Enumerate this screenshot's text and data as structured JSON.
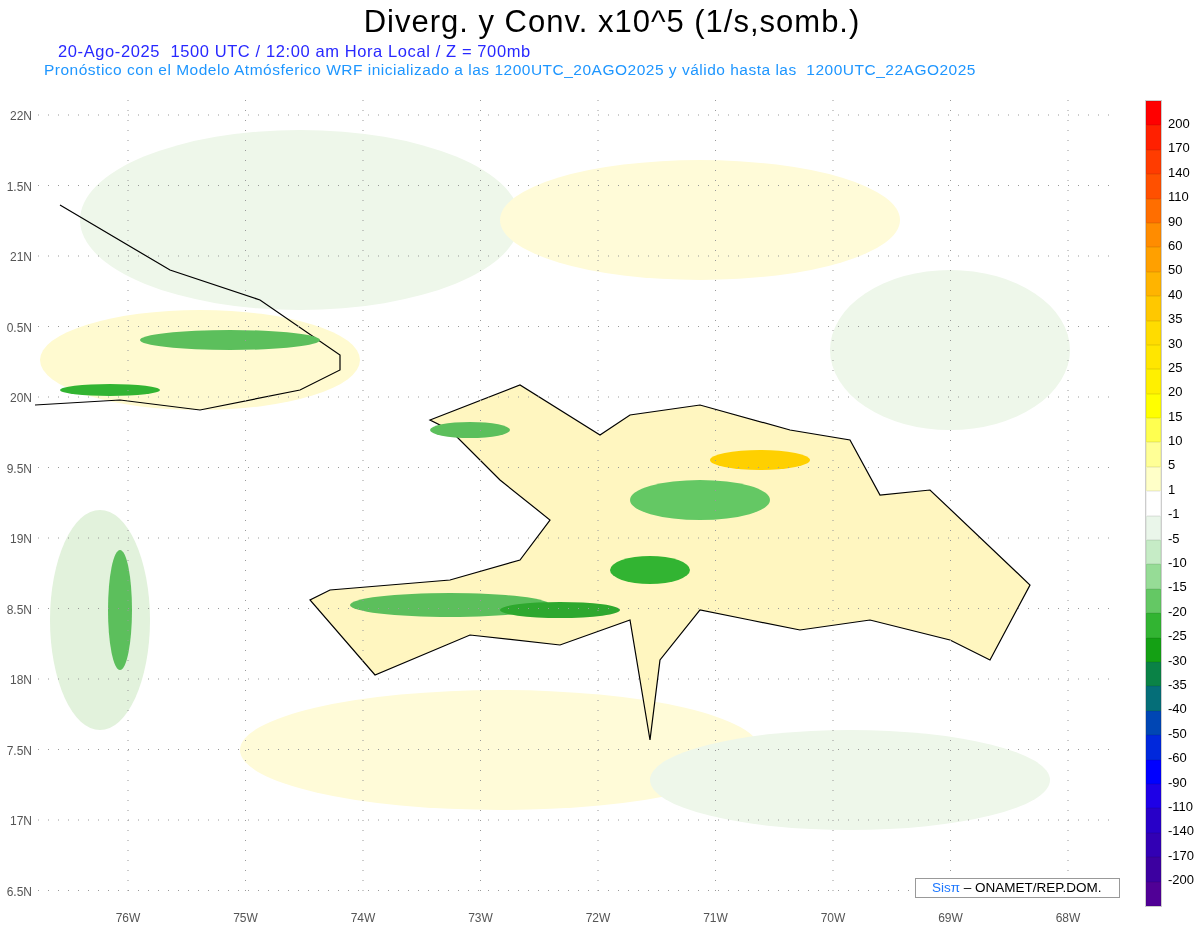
{
  "title": "Diverg. y Conv. x10^5 (1/s,somb.)",
  "subtitle": "20-Ago-2025  1500 UTC / 12:00 am Hora Local / Z = 700mb",
  "forecast_note": "Pronóstico con el Modelo Atmósferico WRF inicializado a las 1200UTC_20AGO2025 y válido hasta las  1200UTC_22AGO2025",
  "map": {
    "y_labels": [
      "22N",
      "1.5N",
      "21N",
      "0.5N",
      "20N",
      "9.5N",
      "19N",
      "8.5N",
      "18N",
      "7.5N",
      "17N",
      "6.5N"
    ],
    "x_labels": [
      "76W",
      "75W",
      "74W",
      "73W",
      "72W",
      "71W",
      "70W",
      "69W",
      "68W"
    ],
    "credit": {
      "brand": "Sisπ",
      "text": "– ONAMET/REP.DOM."
    }
  },
  "colorbar": {
    "segments": [
      {
        "color": "#ff0000"
      },
      {
        "color": "#ff2000"
      },
      {
        "color": "#ff3c00"
      },
      {
        "color": "#ff5000"
      },
      {
        "color": "#ff6e00"
      },
      {
        "color": "#ff8c00"
      },
      {
        "color": "#ffa000"
      },
      {
        "color": "#ffb400"
      },
      {
        "color": "#ffc800"
      },
      {
        "color": "#ffdc00"
      },
      {
        "color": "#ffe600"
      },
      {
        "color": "#fff000"
      },
      {
        "color": "#ffff00"
      },
      {
        "color": "#ffff50"
      },
      {
        "color": "#ffff96"
      },
      {
        "color": "#ffffc8"
      },
      {
        "color": "#ffffff"
      },
      {
        "color": "#eaf6ea"
      },
      {
        "color": "#c6ecc6"
      },
      {
        "color": "#96dc96"
      },
      {
        "color": "#64c864"
      },
      {
        "color": "#32b432"
      },
      {
        "color": "#14a014"
      },
      {
        "color": "#0a8246"
      },
      {
        "color": "#056e78"
      },
      {
        "color": "#0046b4"
      },
      {
        "color": "#0028dc"
      },
      {
        "color": "#0000ff"
      },
      {
        "color": "#1e00e6"
      },
      {
        "color": "#2800c8"
      },
      {
        "color": "#3200b4"
      },
      {
        "color": "#3c00a0"
      },
      {
        "color": "#500096"
      }
    ],
    "labels": [
      "200",
      "170",
      "140",
      "110",
      "90",
      "60",
      "50",
      "40",
      "35",
      "30",
      "25",
      "20",
      "15",
      "10",
      "5",
      "1",
      "-1",
      "-5",
      "-10",
      "-15",
      "-20",
      "-25",
      "-30",
      "-35",
      "-40",
      "-50",
      "-60",
      "-90",
      "-110",
      "-140",
      "-170",
      "-200"
    ]
  }
}
